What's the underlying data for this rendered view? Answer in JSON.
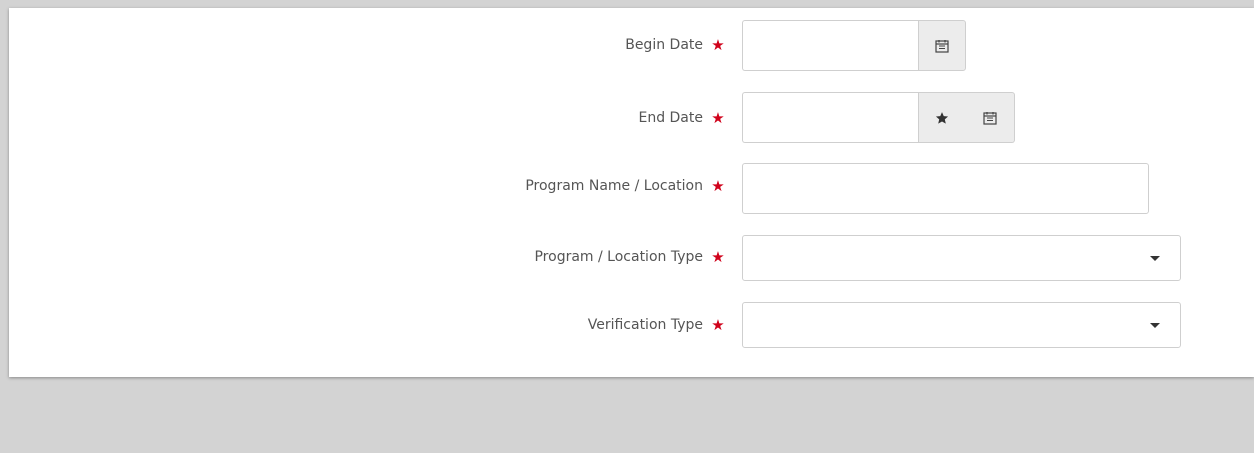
{
  "form": {
    "fields": {
      "begin_date": {
        "label": "Begin Date",
        "required_marker": "★",
        "value": ""
      },
      "end_date": {
        "label": "End Date",
        "required_marker": "★",
        "value": ""
      },
      "program_name_location": {
        "label": "Program Name / Location",
        "required_marker": "★",
        "value": ""
      },
      "program_location_type": {
        "label": "Program / Location Type",
        "required_marker": "★",
        "selected": ""
      },
      "verification_type": {
        "label": "Verification Type",
        "required_marker": "★",
        "selected": ""
      }
    },
    "icons": {
      "calendar": "📅",
      "star": "★"
    }
  },
  "colors": {
    "page_background": "#d3d3d3",
    "card_background": "#ffffff",
    "required_star": "#d0021b",
    "label_text": "#555555",
    "addon_background": "#ececec",
    "border": "#cfcfcf"
  }
}
